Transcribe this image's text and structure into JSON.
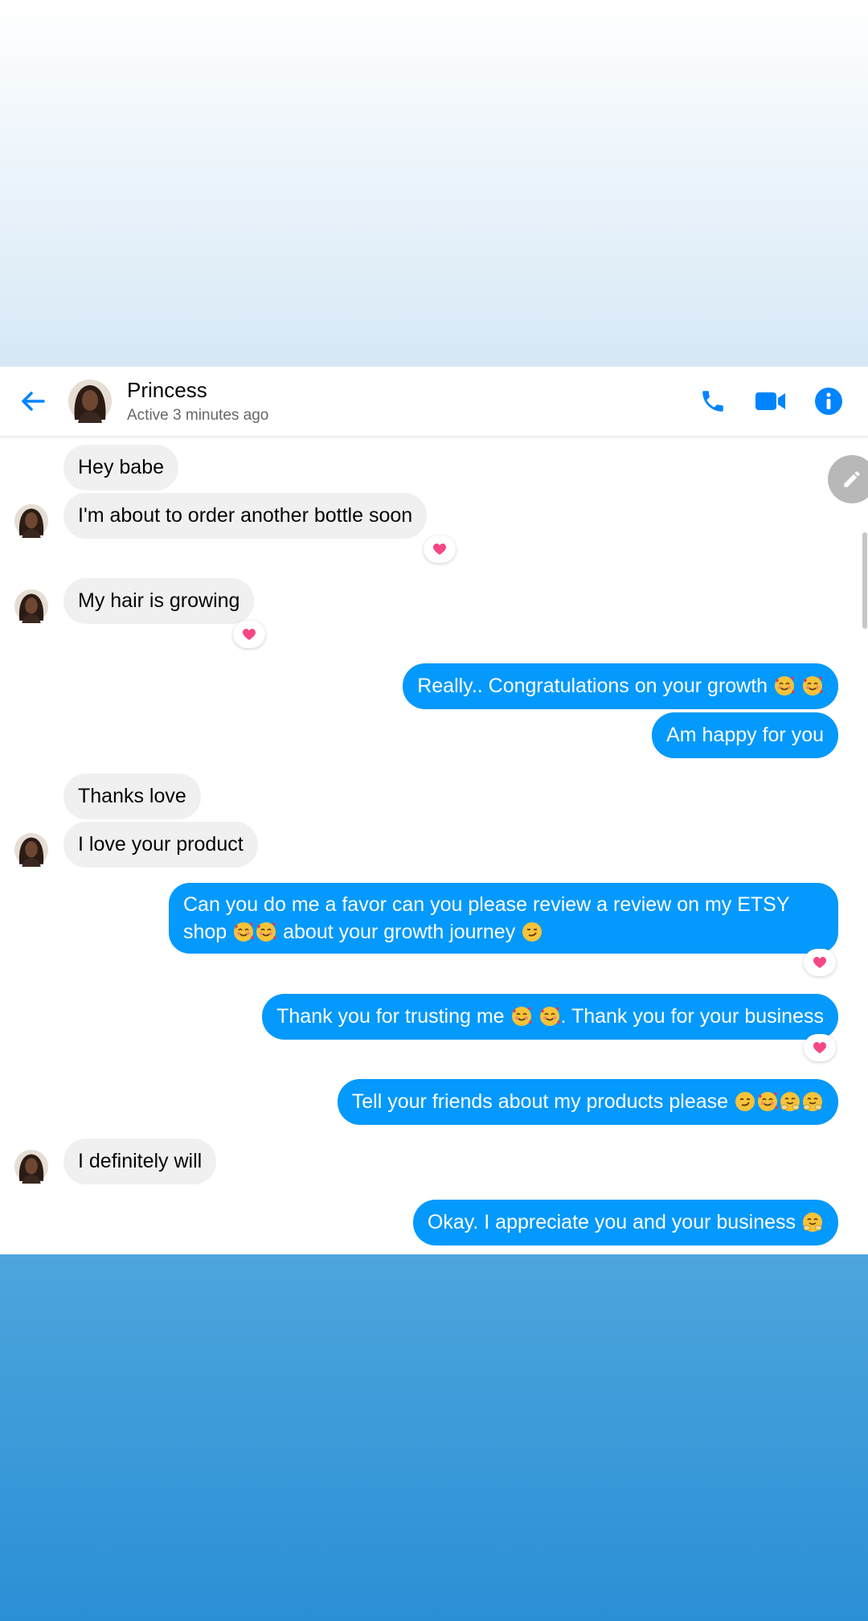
{
  "colors": {
    "accent": "#0084ff",
    "outgoing_bubble": "#0499fc",
    "incoming_bubble": "#f0f0f0",
    "reaction_heart": "#f54785"
  },
  "header": {
    "back_icon": "arrow-left-icon",
    "contact_name": "Princess",
    "status": "Active 3 minutes ago",
    "actions": [
      "phone-icon",
      "video-camera-icon",
      "info-icon"
    ]
  },
  "messages": [
    {
      "direction": "incoming",
      "text": "Hey babe"
    },
    {
      "direction": "incoming",
      "text": "I'm about to order another bottle soon",
      "reaction": "heart"
    },
    {
      "direction": "incoming",
      "text": "My hair is growing",
      "reaction": "heart"
    },
    {
      "direction": "outgoing",
      "text": "Really.. Congratulations on your growth",
      "emojis": [
        "smiling-face-with-hearts",
        "smiling-face-with-hearts"
      ]
    },
    {
      "direction": "outgoing",
      "text": "Am happy for you"
    },
    {
      "direction": "incoming",
      "text": "Thanks love"
    },
    {
      "direction": "incoming",
      "text": "I love your product"
    },
    {
      "direction": "outgoing",
      "text_line1": "Can you do me a favor can you please review a review on my ETSY",
      "text_line2_a": "shop",
      "text_line2_b": "about your growth journey",
      "reaction": "heart"
    },
    {
      "direction": "outgoing",
      "text_a": "Thank you for trusting me",
      "text_b": ". Thank you for your business",
      "reaction": "heart"
    },
    {
      "direction": "outgoing",
      "text": "Tell your friends about my products please",
      "emojis": [
        "smirking-face",
        "smiling-face-with-hearts",
        "hugging-face",
        "hugging-face"
      ]
    },
    {
      "direction": "incoming",
      "text": "I definitely will"
    },
    {
      "direction": "outgoing",
      "text": "Okay. I appreciate you and your business",
      "emojis": [
        "hugging-face"
      ]
    }
  ]
}
